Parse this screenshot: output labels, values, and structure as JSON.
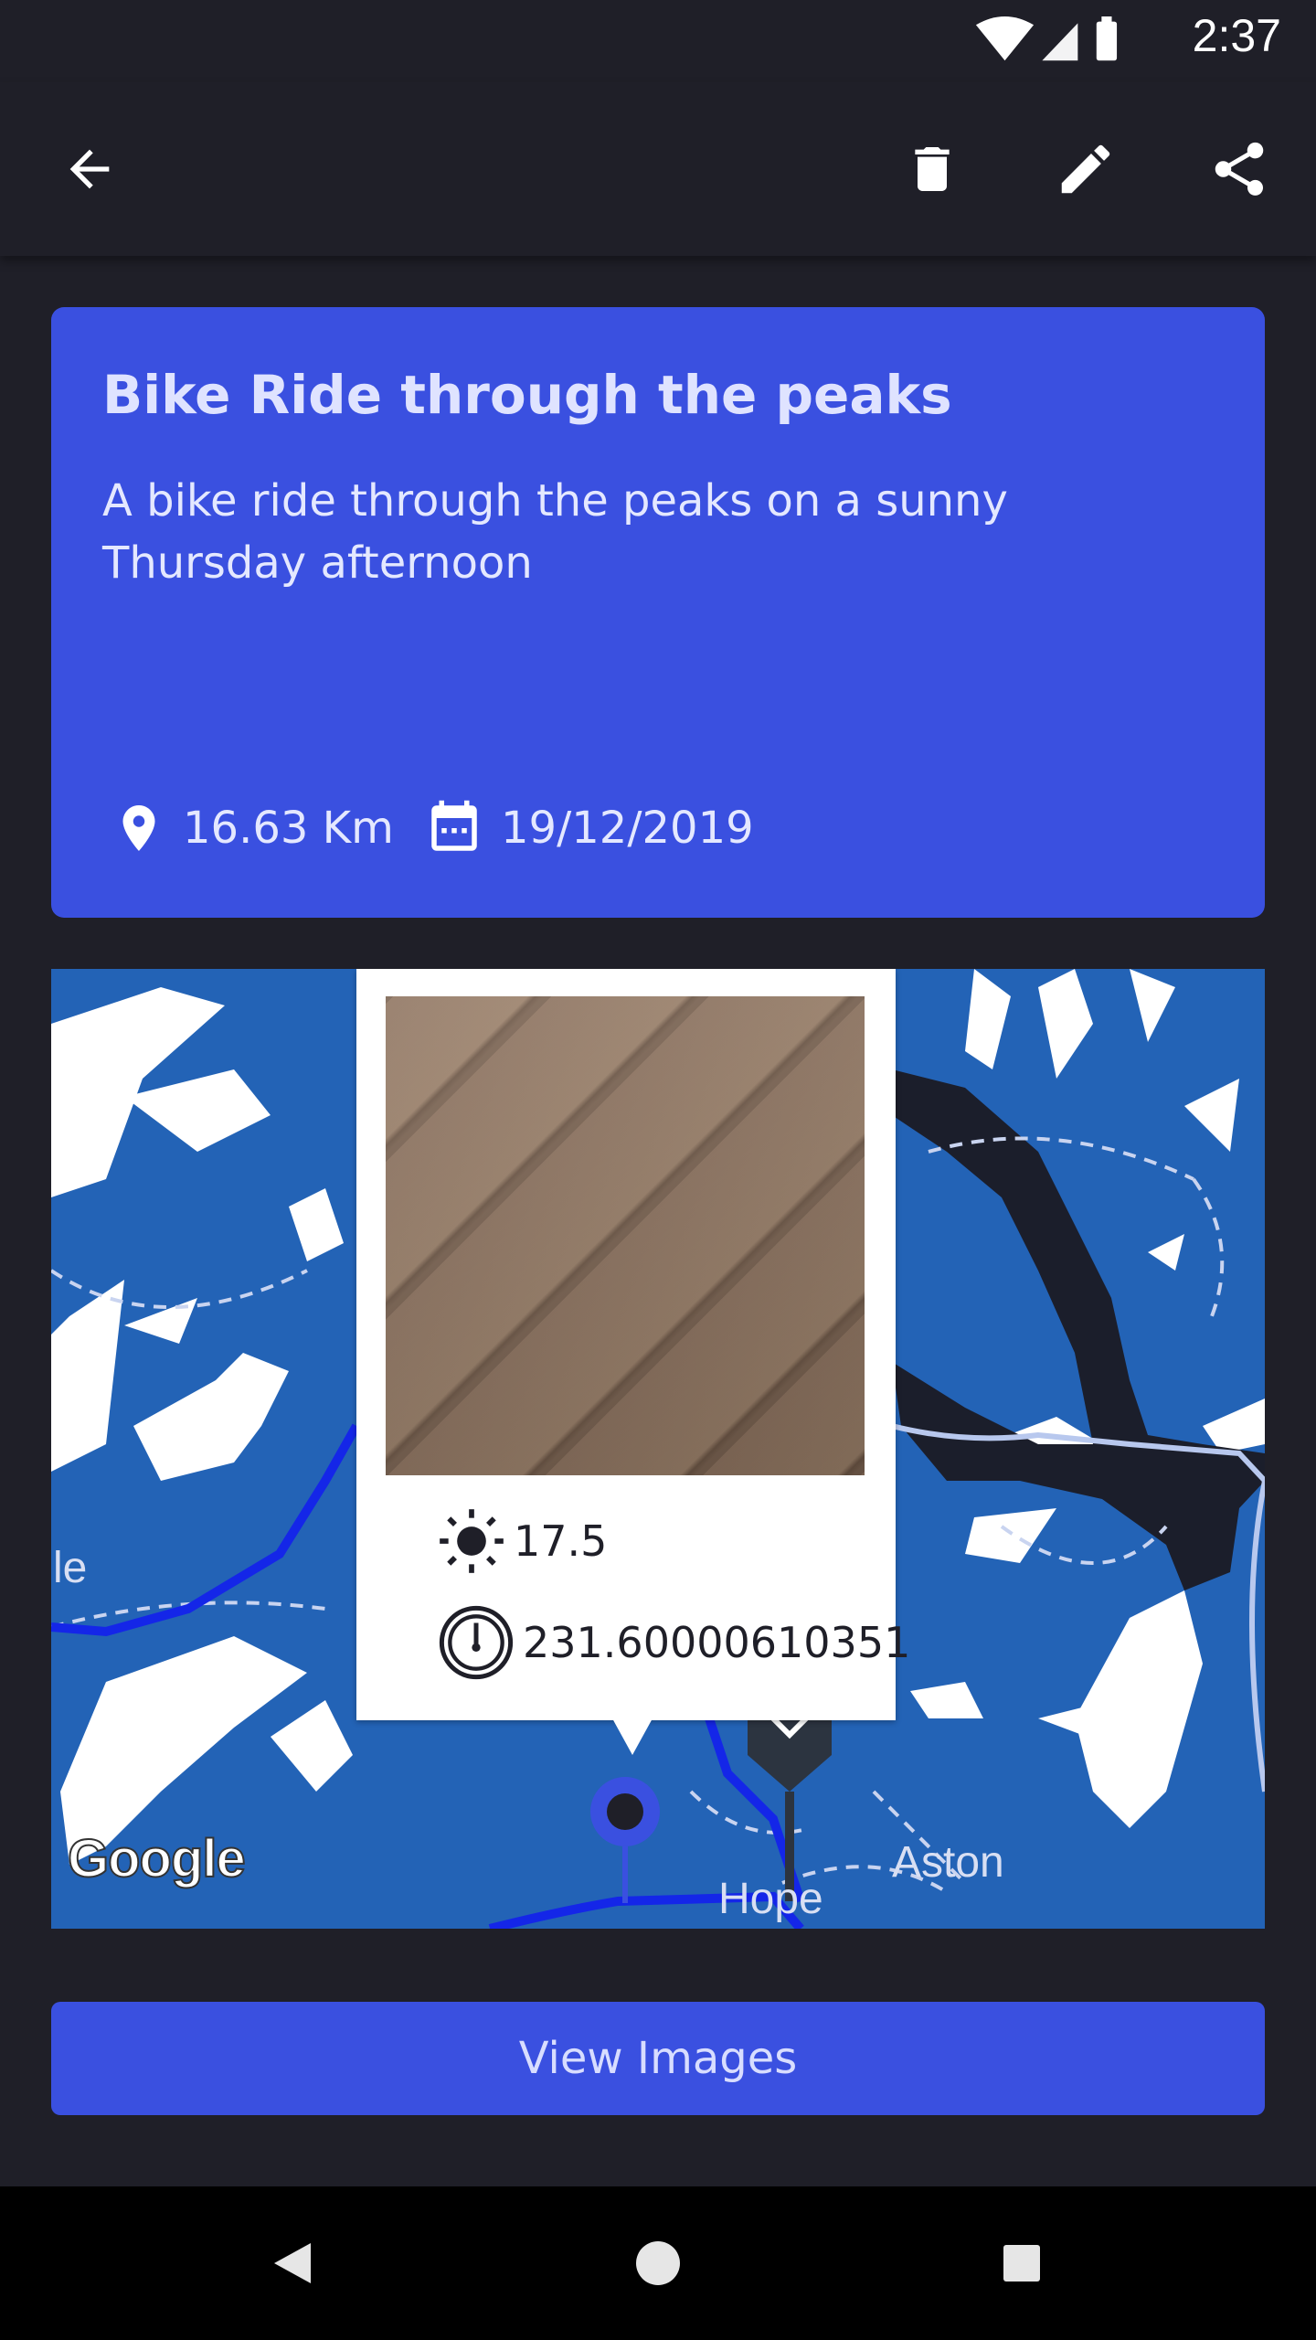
{
  "status_bar": {
    "time": "2:37"
  },
  "app_bar": {
    "back_icon": "arrow-left-icon",
    "actions": [
      "trash-icon",
      "pencil-icon",
      "share-icon"
    ]
  },
  "trip": {
    "title": "Bike Ride through the peaks",
    "description": "A bike ride through the peaks on a sunny Thursday afternoon",
    "distance": "16.63 Km",
    "date": "19/12/2019"
  },
  "map": {
    "popup": {
      "brightness": "17.5",
      "heading": "231.60000610351"
    },
    "labels": {
      "left_fragment": "le",
      "town_1": "Hope",
      "town_2": "Aston"
    },
    "attribution": "Google"
  },
  "view_images_label": "View Images",
  "colors": {
    "accent": "#3a50e0",
    "background": "#1f1f28",
    "map_water": "#2363b6",
    "route": "#1426e8"
  }
}
